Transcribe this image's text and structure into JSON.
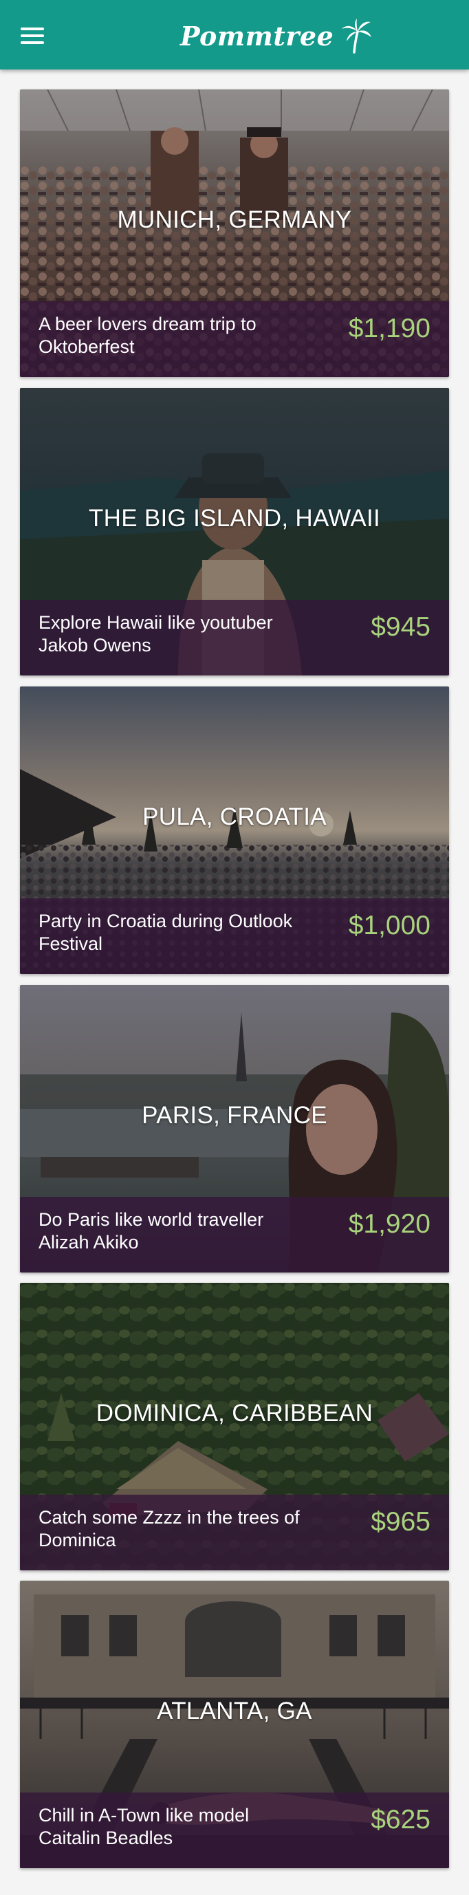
{
  "app": {
    "logo_text": "Pommtree",
    "colors": {
      "app_bar": "#139a8a",
      "price": "#a8d27c",
      "footer_overlay": "#34163a"
    }
  },
  "trips": [
    {
      "location": "MUNICH, GERMANY",
      "description": "A beer lovers dream trip to Oktoberfest",
      "price": "$1,190"
    },
    {
      "location": "THE BIG ISLAND, HAWAII",
      "description": "Explore Hawaii like youtuber Jakob Owens",
      "price": "$945"
    },
    {
      "location": "PULA, CROATIA",
      "description": "Party in Croatia during Outlook Festival",
      "price": "$1,000"
    },
    {
      "location": "PARIS, FRANCE",
      "description": "Do Paris like world traveller Alizah Akiko",
      "price": "$1,920"
    },
    {
      "location": "DOMINICA, CARIBBEAN",
      "description": "Catch some Zzzz in the trees of Dominica",
      "price": "$965"
    },
    {
      "location": "ATLANTA, GA",
      "description": "Chill in A-Town like model Caitalin Beadles",
      "price": "$625"
    }
  ]
}
